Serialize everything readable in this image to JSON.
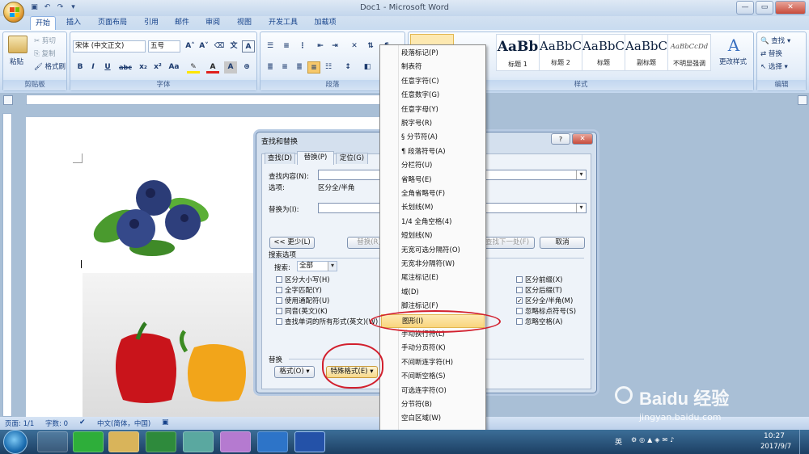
{
  "window": {
    "title": "Doc1 - Microsoft Word"
  },
  "tabs": [
    "开始",
    "插入",
    "页面布局",
    "引用",
    "邮件",
    "审阅",
    "视图",
    "开发工具",
    "加载项"
  ],
  "clipboard": {
    "paste": "粘贴",
    "cut": "剪切",
    "copy": "复制",
    "format_painter": "格式刷",
    "label": "剪贴板"
  },
  "font": {
    "name": "宋体 (中文正文)",
    "size": "五号",
    "label": "字体",
    "bold": "B",
    "italic": "I",
    "underline": "U"
  },
  "paragraph": {
    "label": "段落"
  },
  "styles": {
    "label": "样式",
    "items": [
      {
        "preview": "AaBb",
        "name": "标题 1"
      },
      {
        "preview": "AaBbC",
        "name": "标题 2"
      },
      {
        "preview": "AaBbC",
        "name": "标题"
      },
      {
        "preview": "AaBbC",
        "name": "副标题"
      },
      {
        "preview": "AaBbCcDd",
        "name": "不明显强调"
      }
    ],
    "change": "更改样式"
  },
  "editing": {
    "find": "查找",
    "replace": "替换",
    "select": "选择",
    "label": "编辑"
  },
  "dialog": {
    "title": "查找和替换",
    "tabs": [
      "查找(D)",
      "替换(P)",
      "定位(G)"
    ],
    "find_label": "查找内容(N):",
    "options_label": "选项:",
    "options_value": "区分全/半角",
    "replace_label": "替换为(I):",
    "less_btn": "<< 更少(L)",
    "replace_btn": "替换(R)",
    "find_next_btn": "查找下一处(F)",
    "cancel_btn": "取消",
    "search_options": "搜索选项",
    "search_label": "搜索:",
    "search_value": "全部",
    "left_checks": [
      {
        "label": "区分大小写(H)",
        "checked": false
      },
      {
        "label": "全字匹配(Y)",
        "checked": false
      },
      {
        "label": "使用通配符(U)",
        "checked": false
      },
      {
        "label": "同音(英文)(K)",
        "checked": false
      },
      {
        "label": "查找单词的所有形式(英文)(W)",
        "checked": false
      }
    ],
    "right_checks": [
      {
        "label": "区分前缀(X)",
        "checked": false
      },
      {
        "label": "区分后缀(T)",
        "checked": false
      },
      {
        "label": "区分全/半角(M)",
        "checked": true
      },
      {
        "label": "忽略标点符号(S)",
        "checked": false
      },
      {
        "label": "忽略空格(A)",
        "checked": false
      }
    ],
    "replace_section": "替换",
    "format_btn": "格式(O) ▾",
    "special_btn": "特殊格式(E) ▾"
  },
  "menu": {
    "items": [
      "段落标记(P)",
      "制表符",
      "任意字符(C)",
      "任意数字(G)",
      "任意字母(Y)",
      "脱字号(R)",
      "§ 分节符(A)",
      "¶ 段落符号(A)",
      "分栏符(U)",
      "省略号(E)",
      "全角省略号(F)",
      "长划线(M)",
      "1/4 全角空格(4)",
      "短划线(N)",
      "无宽可选分隔符(O)",
      "无宽非分隔符(W)",
      "尾注标记(E)",
      "域(D)",
      "脚注标记(F)",
      "图形(I)",
      "手动换行符(L)",
      "手动分页符(K)",
      "不间断连字符(H)",
      "不间断空格(S)",
      "可选连字符(O)",
      "分节符(B)",
      "空白区域(W)"
    ],
    "highlighted_index": 19
  },
  "status": {
    "page": "页面: 1/1",
    "words": "字数: 0",
    "lang": "中文(简体，中国)"
  },
  "taskbar": {
    "time": "10:27",
    "date": "2017/9/7",
    "ime": "英"
  },
  "watermark": {
    "text": "Baidu 经验",
    "url": "jingyan.baidu.com"
  }
}
